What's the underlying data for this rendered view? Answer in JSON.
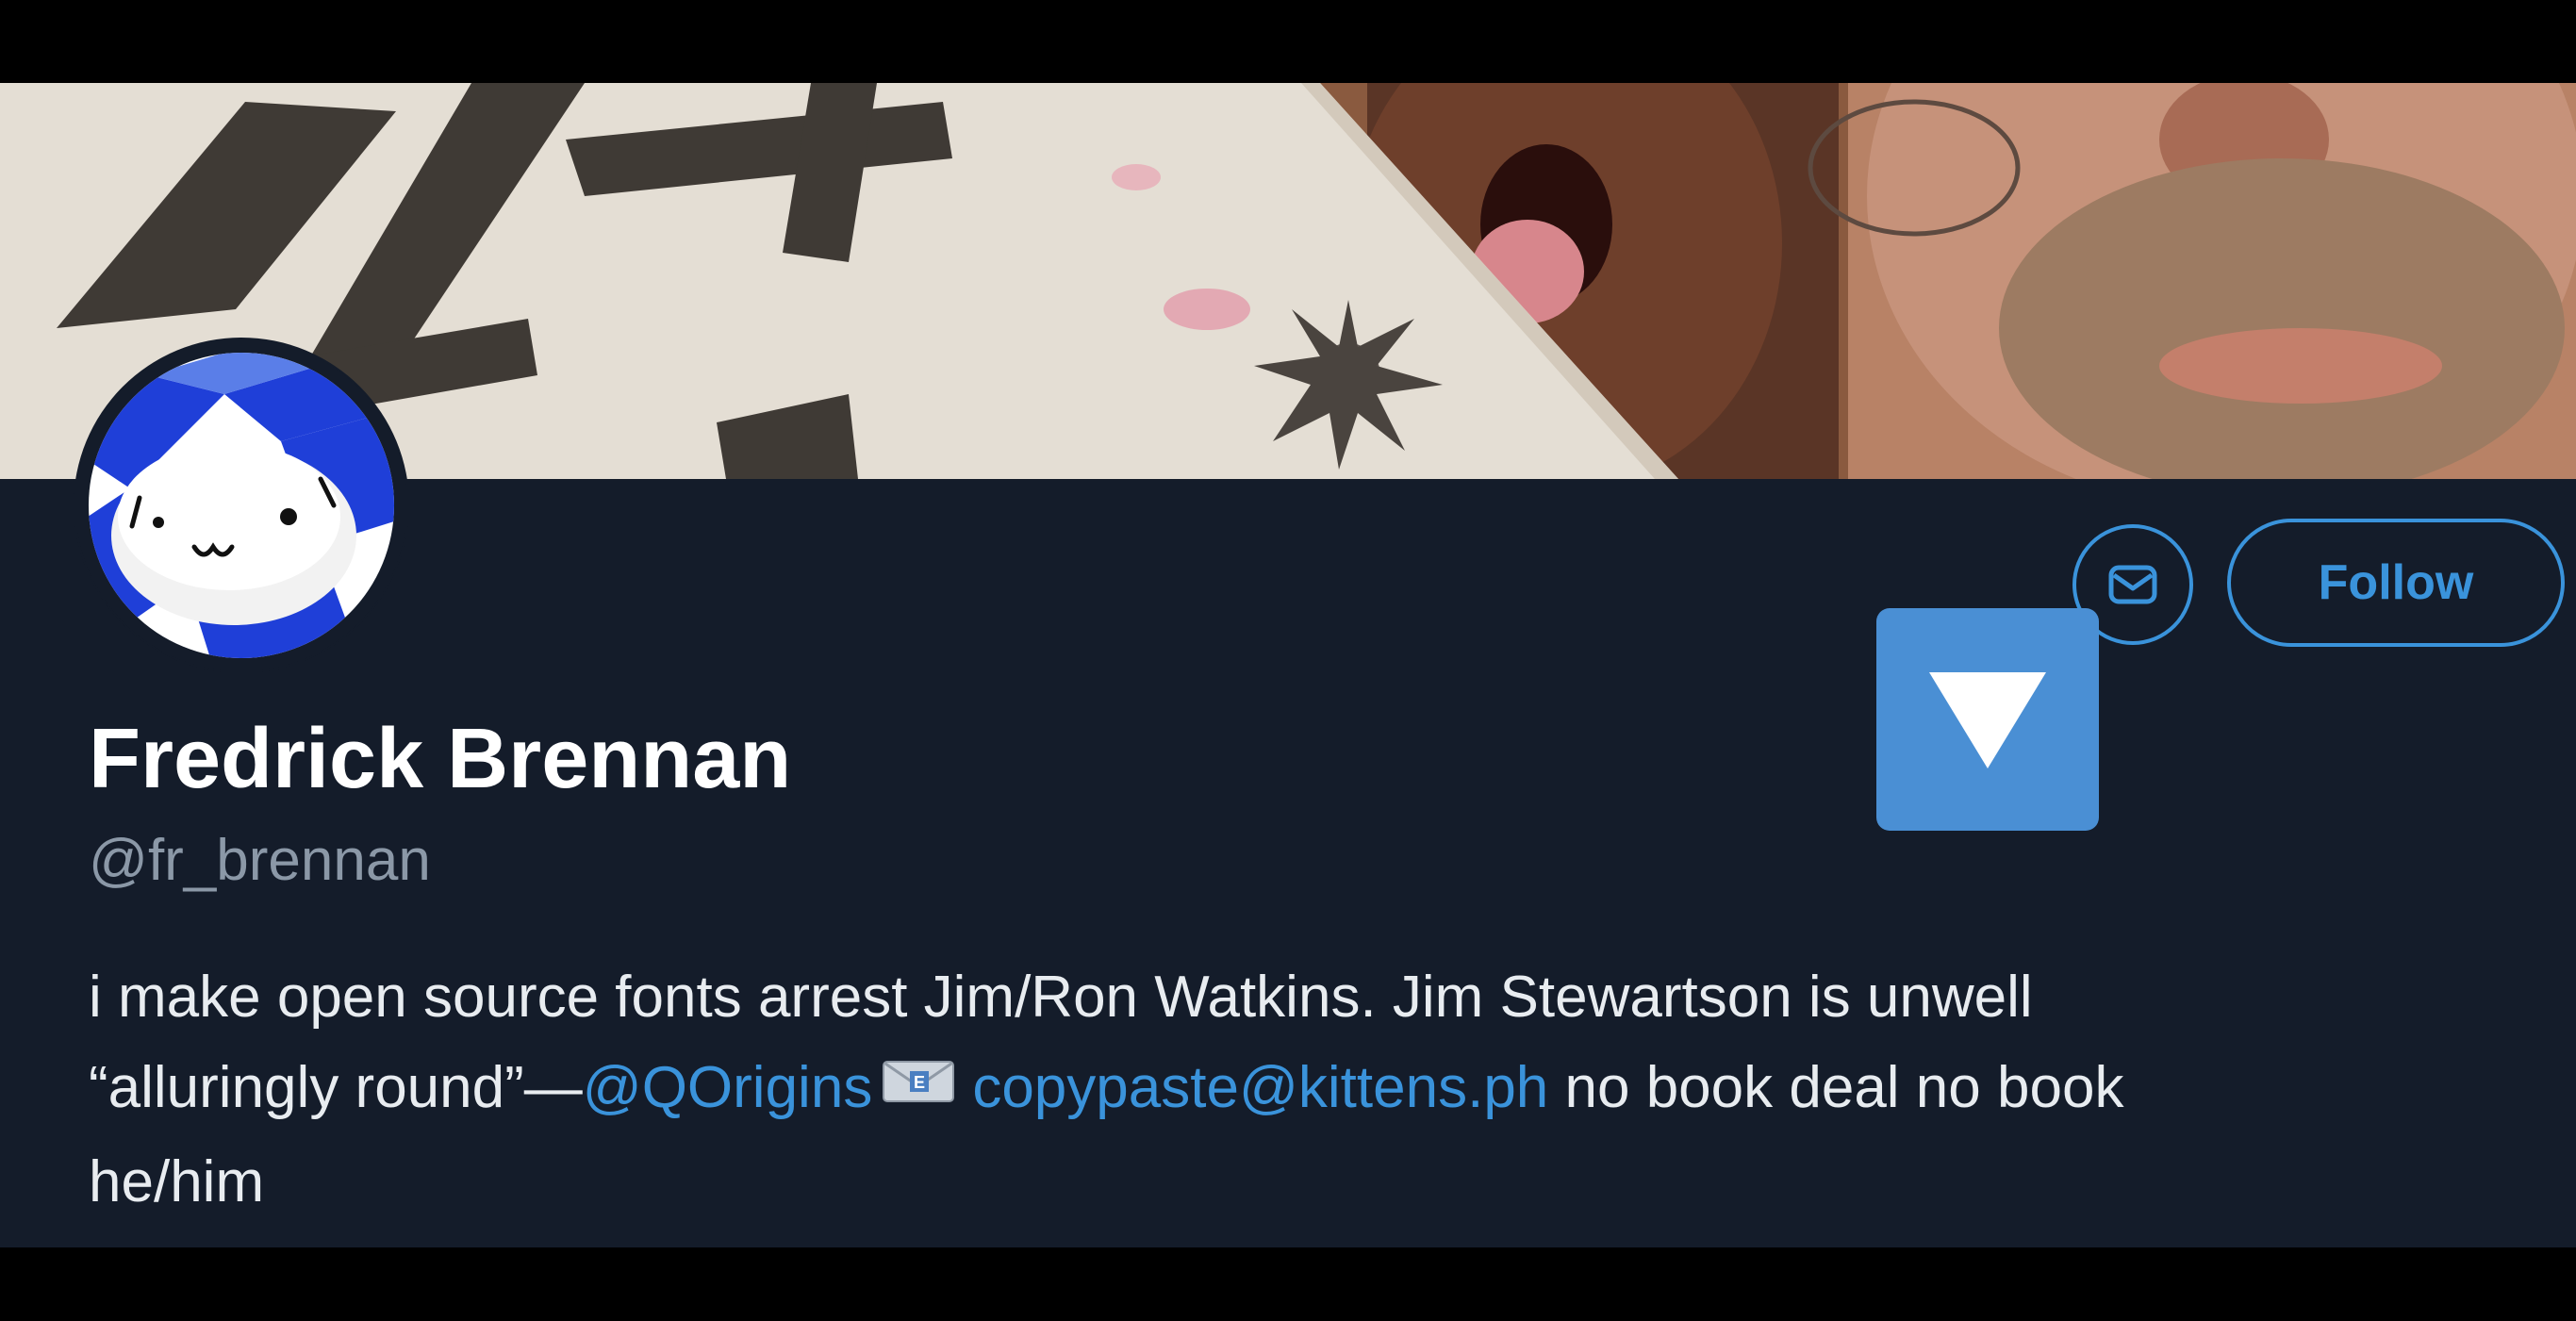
{
  "profile": {
    "display_name": "Fredrick Brennan",
    "handle": "@fr_brennan",
    "bio": {
      "line1": "i make open source fonts arrest Jim/Ron Watkins. Jim Stewartson is unwell",
      "line2_quote": "“alluringly round”—",
      "line2_mention": "@QOrigins",
      "line2_email": "copypaste@kittens.ph",
      "line2_rest": " no book deal no book",
      "line3": "he/him"
    }
  },
  "actions": {
    "message_icon": "envelope-icon",
    "follow_label": "Follow"
  },
  "colors": {
    "panel_bg": "#141c2a",
    "accent": "#3a93db",
    "handle_gray": "#8b98a7",
    "dropdown_tile": "#4a8fd4"
  }
}
